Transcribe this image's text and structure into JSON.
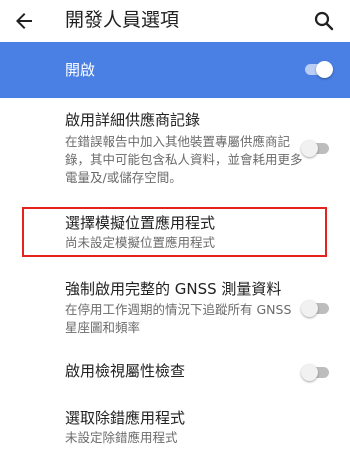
{
  "appbar": {
    "title": "開發人員選項",
    "back_icon": "arrow-back-icon",
    "search_icon": "search-icon"
  },
  "master_toggle": {
    "label": "開啟",
    "on": true
  },
  "settings": [
    {
      "title": "啟用詳細供應商記錄",
      "subtitle": "在錯誤報告中加入其他裝置專屬供應商記錄，其中可能包含私人資料，並會耗用更多電量及/或儲存空間。",
      "toggle": "off"
    },
    {
      "title": "選擇模擬位置應用程式",
      "subtitle": "尚未設定模擬位置應用程式",
      "highlighted": true
    },
    {
      "title": "強制啟用完整的 GNSS 測量資料",
      "subtitle": "在停用工作週期的情況下追蹤所有 GNSS 星座圖和頻率",
      "toggle": "off"
    },
    {
      "title": "啟用檢視屬性檢查",
      "toggle": "off"
    },
    {
      "title": "選取除錯應用程式",
      "subtitle": "未設定除錯應用程式"
    }
  ],
  "colors": {
    "accent": "#4a7fe4",
    "highlight_border": "#e5221d"
  }
}
